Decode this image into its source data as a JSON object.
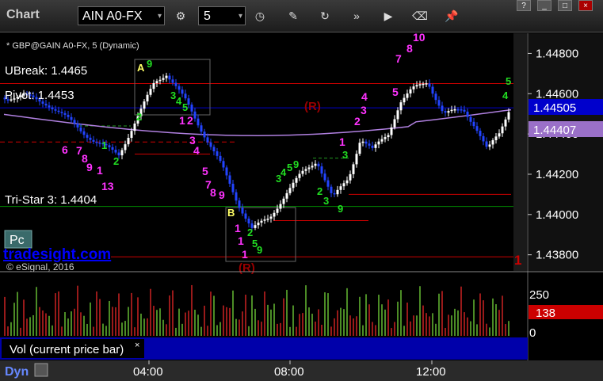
{
  "toolbar": {
    "title": "Chart",
    "symbol": "AIN A0-FX",
    "interval": "5",
    "icons": [
      "gear-icon",
      "clock-icon",
      "pencil-icon",
      "refresh-icon",
      "fast-forward-icon",
      "play-icon",
      "eraser-icon",
      "pin-icon"
    ]
  },
  "window_buttons": [
    "?",
    "_",
    "□",
    "×"
  ],
  "chart": {
    "header": "* GBP@GAIN A0-FX, 5 (Dynamic)",
    "watermark": "tradesight.com",
    "copyright": "© eSignal, 2016",
    "button": "Pc",
    "labels": {
      "ubreak": "UBreak: 1.4465",
      "pivot": "Pivot: 1.4453",
      "tristar": "Tri-Star 3: 1.4404",
      "a": "A",
      "b": "B",
      "r1": "(R)",
      "r2": "(R)",
      "edge": "1"
    },
    "price_axis": [
      "1.44800",
      "1.44600",
      "1.44400",
      "1.44200",
      "1.44000",
      "1.43800"
    ],
    "last_price": "1.44505",
    "ma_price": "1.44407",
    "volume_axis": [
      "250",
      "138",
      "0"
    ],
    "volume_label": "Vol (current price bar)",
    "volume_close": "×",
    "time_axis": [
      "04:00",
      "08:00",
      "12:00"
    ],
    "footer": "Dyn"
  },
  "chart_data": {
    "type": "candlestick",
    "series": [
      {
        "name": "GBP@GAIN A0-FX",
        "interval": "5"
      }
    ],
    "ylim": [
      1.4372,
      1.449
    ],
    "levels": [
      {
        "value": 1.4465,
        "color": "#cc0000"
      },
      {
        "value": 1.4453,
        "color": "#0000cc"
      },
      {
        "value": 1.4404,
        "color": "#008800"
      },
      {
        "value": 1.4436,
        "color": "#cc0000",
        "dashed": true
      }
    ],
    "last_price": 1.44505,
    "moving_average": 1.44407,
    "volume": {
      "last": 138,
      "ylim": [
        0,
        300
      ]
    },
    "colors": {
      "up": "#ffffff",
      "down": "#2244ff",
      "ma": "#b080e0",
      "td_magenta": "#ff33ff",
      "td_green": "#22dd22"
    }
  }
}
